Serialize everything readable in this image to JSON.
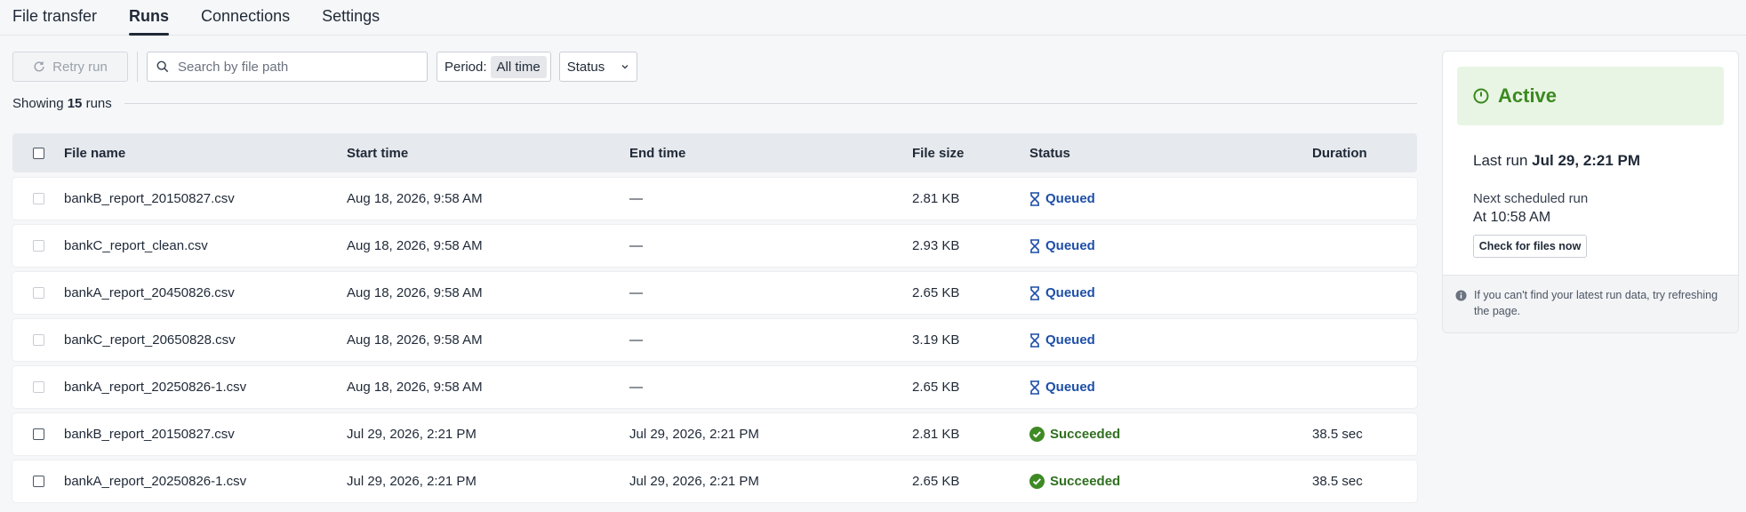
{
  "tabs": [
    {
      "label": "File transfer",
      "active": false
    },
    {
      "label": "Runs",
      "active": true
    },
    {
      "label": "Connections",
      "active": false
    },
    {
      "label": "Settings",
      "active": false
    }
  ],
  "toolbar": {
    "retry_label": "Retry run",
    "search_placeholder": "Search by file path",
    "period_label": "Period:",
    "period_value": "All time",
    "status_label": "Status"
  },
  "showing": {
    "prefix": "Showing",
    "count": "15",
    "suffix": "runs"
  },
  "table": {
    "headers": {
      "name": "File name",
      "start": "Start time",
      "end": "End time",
      "size": "File size",
      "status": "Status",
      "duration": "Duration"
    },
    "rows": [
      {
        "name": "bankB_report_20150827.csv",
        "start": "Aug 18, 2026, 9:58 AM",
        "end": "—",
        "size": "2.81 KB",
        "status": "Queued",
        "duration": ""
      },
      {
        "name": "bankC_report_clean.csv",
        "start": "Aug 18, 2026, 9:58 AM",
        "end": "—",
        "size": "2.93 KB",
        "status": "Queued",
        "duration": ""
      },
      {
        "name": "bankA_report_20450826.csv",
        "start": "Aug 18, 2026, 9:58 AM",
        "end": "—",
        "size": "2.65 KB",
        "status": "Queued",
        "duration": ""
      },
      {
        "name": "bankC_report_20650828.csv",
        "start": "Aug 18, 2026, 9:58 AM",
        "end": "—",
        "size": "3.19 KB",
        "status": "Queued",
        "duration": ""
      },
      {
        "name": "bankA_report_20250826-1.csv",
        "start": "Aug 18, 2026, 9:58 AM",
        "end": "—",
        "size": "2.65 KB",
        "status": "Queued",
        "duration": ""
      },
      {
        "name": "bankB_report_20150827.csv",
        "start": "Jul 29, 2026, 2:21 PM",
        "end": "Jul 29, 2026, 2:21 PM",
        "size": "2.81 KB",
        "status": "Succeeded",
        "duration": "38.5 sec"
      },
      {
        "name": "bankA_report_20250826-1.csv",
        "start": "Jul 29, 2026, 2:21 PM",
        "end": "Jul 29, 2026, 2:21 PM",
        "size": "2.65 KB",
        "status": "Succeeded",
        "duration": "38.5 sec"
      }
    ]
  },
  "panel": {
    "status": "Active",
    "last_run_label": "Last run",
    "last_run_value": "Jul 29, 2:21 PM",
    "next_label": "Next scheduled run",
    "next_value": "At 10:58 AM",
    "check_label": "Check for files now",
    "footer_text": "If you can't find your latest run data, try refreshing the page."
  },
  "colors": {
    "queued": "#1e4fa8",
    "succeeded": "#2f6f1f",
    "active": "#3a8a1f"
  }
}
